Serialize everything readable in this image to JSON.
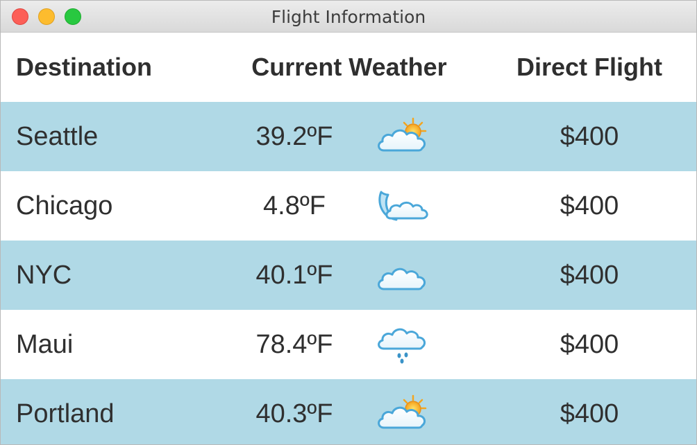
{
  "window": {
    "title": "Flight Information"
  },
  "table": {
    "headers": {
      "destination": "Destination",
      "weather": "Current Weather",
      "flight": "Direct Flight"
    },
    "rows": [
      {
        "destination": "Seattle",
        "temperature": "39.2ºF",
        "weather_icon": "partly-cloudy-icon",
        "price": "$400"
      },
      {
        "destination": "Chicago",
        "temperature": "4.8ºF",
        "weather_icon": "cloudy-night-icon",
        "price": "$400"
      },
      {
        "destination": "NYC",
        "temperature": "40.1ºF",
        "weather_icon": "cloud-icon",
        "price": "$400"
      },
      {
        "destination": "Maui",
        "temperature": "78.4ºF",
        "weather_icon": "rain-icon",
        "price": "$400"
      },
      {
        "destination": "Portland",
        "temperature": "40.3ºF",
        "weather_icon": "partly-cloudy-icon",
        "price": "$400"
      }
    ]
  },
  "colors": {
    "row_alt": "#b0d9e6",
    "text": "#2f2f2f"
  }
}
